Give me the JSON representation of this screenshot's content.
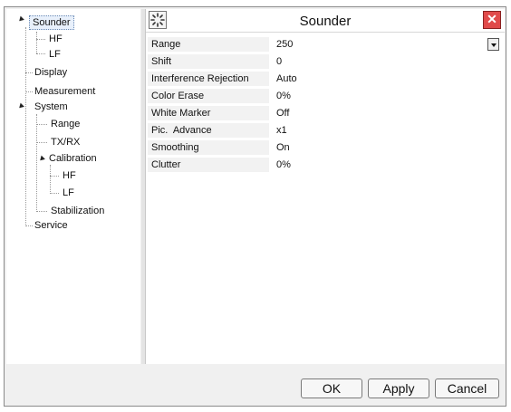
{
  "tree": {
    "items": [
      {
        "label": "Sounder"
      },
      {
        "label": "HF"
      },
      {
        "label": "LF"
      },
      {
        "label": "Display"
      },
      {
        "label": "Measurement"
      },
      {
        "label": "System"
      },
      {
        "label": "Range"
      },
      {
        "label": "TX/RX"
      },
      {
        "label": "Calibration"
      },
      {
        "label": "HF"
      },
      {
        "label": "LF"
      },
      {
        "label": "Stabilization"
      },
      {
        "label": "Service"
      }
    ],
    "selected": "Sounder"
  },
  "panel": {
    "title": "Sounder",
    "icon": "settings-sparkle-icon",
    "close_icon": "close-icon",
    "properties": [
      {
        "name": "Range",
        "value": "250",
        "has_dropdown": true
      },
      {
        "name": "Shift",
        "value": "0"
      },
      {
        "name": "Interference Rejection",
        "value": "Auto"
      },
      {
        "name": "Color Erase",
        "value": "0%"
      },
      {
        "name": "White Marker",
        "value": "Off"
      },
      {
        "name": "Pic.  Advance",
        "value": "x1"
      },
      {
        "name": "Smoothing",
        "value": "On"
      },
      {
        "name": "Clutter",
        "value": "0%"
      }
    ]
  },
  "buttons": {
    "ok": "OK",
    "apply": "Apply",
    "cancel": "Cancel"
  },
  "colors": {
    "close_button": "#e04a4a",
    "selection_border": "#6a8ab5"
  }
}
